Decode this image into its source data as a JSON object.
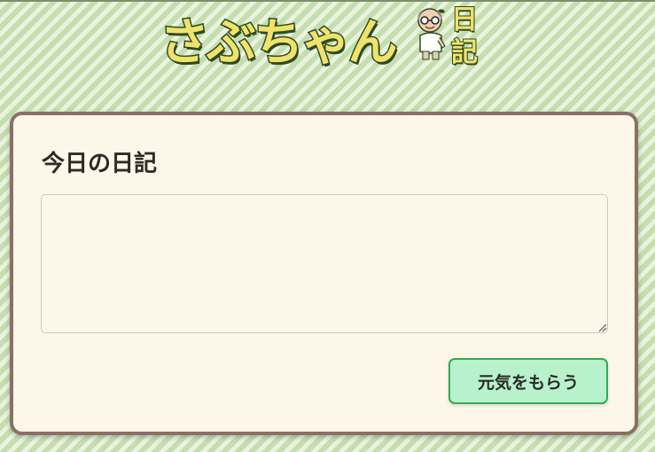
{
  "logo": {
    "main_text": "さぶちゃん",
    "side_char_1": "日",
    "side_char_2": "記"
  },
  "card": {
    "title": "今日の日記",
    "textarea_value": "",
    "textarea_placeholder": ""
  },
  "actions": {
    "submit_label": "元気をもらう"
  },
  "colors": {
    "background_stripe_dark": "#c4deb0",
    "background_stripe_light": "#e9f3dd",
    "card_background": "#fdf7ea",
    "card_border": "#8a7064",
    "button_background": "#b8f2cc",
    "button_border": "#33aa55",
    "logo_fill": "#f0e36a",
    "logo_outline": "#2f4a22"
  }
}
